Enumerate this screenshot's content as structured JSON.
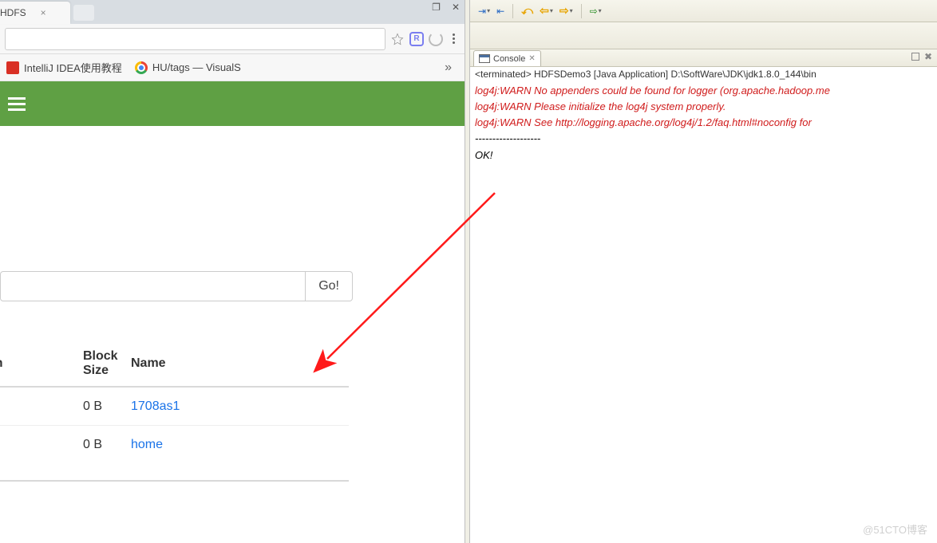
{
  "browser": {
    "tab_title": "HDFS",
    "bookmarks": [
      {
        "label": "IntelliJ IDEA使用教程",
        "icon": "red"
      },
      {
        "label": "HU/tags — VisualS",
        "icon": "chrome"
      }
    ],
    "ext_badge": "R"
  },
  "hdfs": {
    "go_label": "Go!",
    "cols": {
      "on": "on",
      "block_size": "Block Size",
      "name": "Name"
    },
    "rows": [
      {
        "block_size": "0 B",
        "name": "1708as1"
      },
      {
        "block_size": "0 B",
        "name": "home"
      }
    ]
  },
  "eclipse": {
    "view_tab": "Console",
    "term_line": "<terminated> HDFSDemo3 [Java Application] D:\\SoftWare\\JDK\\jdk1.8.0_144\\bin",
    "lines_red": [
      "log4j:WARN No appenders could be found for logger (org.apache.hadoop.me",
      "log4j:WARN Please initialize the log4j system properly.",
      "log4j:WARN See http://logging.apache.org/log4j/1.2/faq.html#noconfig for"
    ],
    "lines_black": [
      "-------------------",
      "OK!"
    ]
  },
  "watermark": "@51CTO博客"
}
